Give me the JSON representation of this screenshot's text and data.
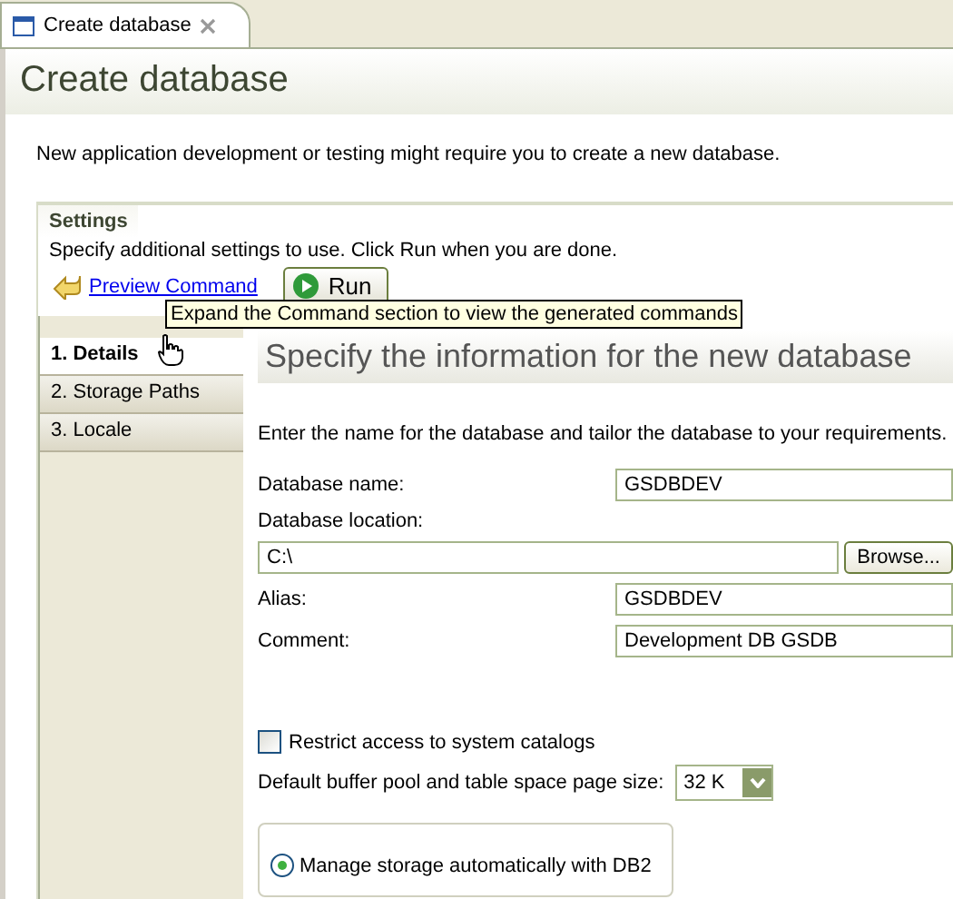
{
  "editor_tab": {
    "title": "Create database"
  },
  "header": {
    "title": "Create database",
    "description": "New application development or testing might require you to create a new database."
  },
  "settings": {
    "title": "Settings",
    "description": "Specify additional settings to use. Click Run when you are done.",
    "preview_link": "Preview Command",
    "run_button": "Run",
    "tooltip": "Expand the Command section to view the generated commands"
  },
  "nav": [
    {
      "label": "1. Details",
      "selected": true
    },
    {
      "label": "2. Storage Paths",
      "selected": false
    },
    {
      "label": "3. Locale",
      "selected": false
    }
  ],
  "details": {
    "heading": "Specify the information for the new database",
    "description": "Enter the name for the database and tailor the database to your requirements.",
    "fields": [
      {
        "kind": "inline",
        "label": "Database name:",
        "value": "GSDBDEV"
      },
      {
        "kind": "browse",
        "label": "Database location:",
        "value": "C:\\",
        "button": "Browse..."
      },
      {
        "kind": "inline",
        "label": "Alias:",
        "value": "GSDBDEV"
      },
      {
        "kind": "inline",
        "label": "Comment:",
        "value": "Development DB GSDB"
      }
    ],
    "restrict": {
      "label": "Restrict access to system catalogs",
      "checked": false
    },
    "page_size": {
      "label": "Default buffer pool and table space page size:",
      "value": "32 K"
    },
    "storage": [
      {
        "label": "Manage storage automatically with DB2",
        "selected": true
      }
    ]
  }
}
